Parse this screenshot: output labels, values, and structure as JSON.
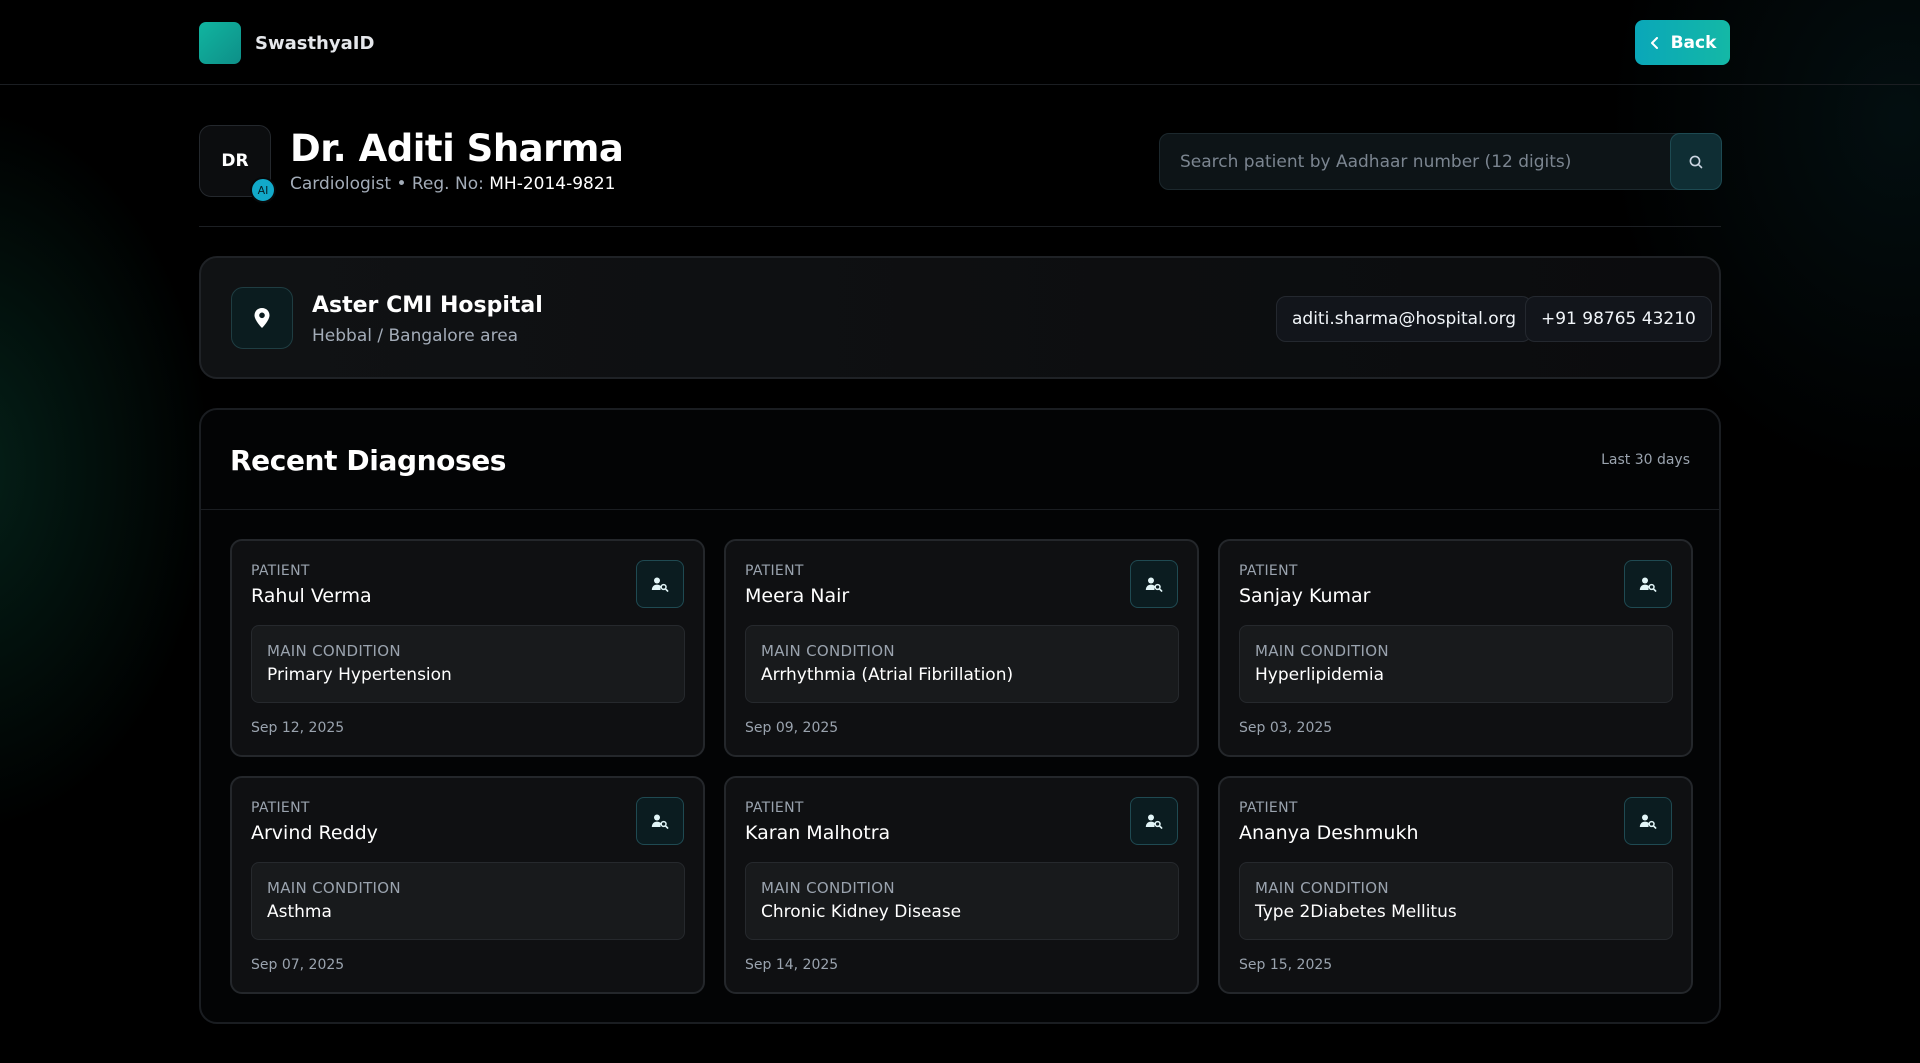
{
  "app": {
    "brand_name": "SwasthyaID",
    "back_label": "Back",
    "accent_color": "#14b8a6"
  },
  "doctor": {
    "initials": "DR",
    "badge": "AI",
    "name": "Dr. Aditi Sharma",
    "specialty_prefix": "Cardiologist • Reg. No: ",
    "reg_no": "MH-2014-9821"
  },
  "search": {
    "placeholder": "Search patient by Aadhaar number (12 digits)",
    "value": "",
    "icon": "search-icon"
  },
  "hospital": {
    "name": "Aster CMI Hospital",
    "area": "Hebbal / Bangalore area",
    "email": "aditi.sharma@hospital.org",
    "phone": "+91 98765 43210",
    "icon": "map-pin-icon"
  },
  "diagnoses": {
    "title": "Recent Diagnoses",
    "range": "Last 30 days",
    "patient_label": "PATIENT",
    "condition_label": "MAIN CONDITION",
    "items": [
      {
        "patient": "Rahul Verma",
        "condition": "Primary Hypertension",
        "date": "Sep 12, 2025"
      },
      {
        "patient": "Meera Nair",
        "condition": "Arrhythmia (Atrial Fibrillation)",
        "date": "Sep 09, 2025"
      },
      {
        "patient": "Sanjay Kumar",
        "condition": "Hyperlipidemia",
        "date": "Sep 03, 2025"
      },
      {
        "patient": "Arvind Reddy",
        "condition": "Asthma",
        "date": "Sep 07, 2025"
      },
      {
        "patient": "Karan Malhotra",
        "condition": "Chronic Kidney Disease",
        "date": "Sep 14, 2025"
      },
      {
        "patient": "Ananya Deshmukh",
        "condition": "Type 2Diabetes Mellitus",
        "date": "Sep 15, 2025"
      }
    ]
  }
}
